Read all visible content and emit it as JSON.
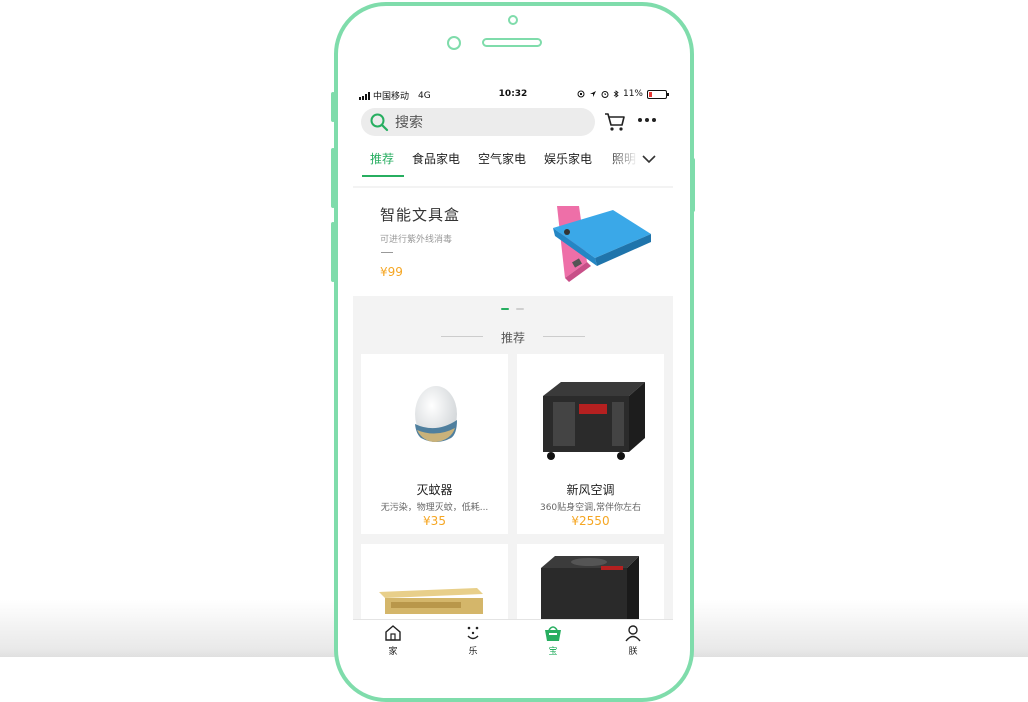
{
  "status_bar": {
    "carrier": "中国移动",
    "network": "4G",
    "time": "10:32",
    "battery": "11%"
  },
  "search": {
    "placeholder": "搜索"
  },
  "tabs": [
    {
      "label": "推荐",
      "active": true
    },
    {
      "label": "食品家电"
    },
    {
      "label": "空气家电"
    },
    {
      "label": "娱乐家电"
    },
    {
      "label": "照明"
    }
  ],
  "banner": {
    "title": "智能文具盒",
    "subtitle": "可进行紫外线消毒",
    "price": "¥99",
    "pages": 2,
    "current_page": 1
  },
  "section": {
    "title": "推荐"
  },
  "products": [
    {
      "name": "灭蚊器",
      "desc": "无污染，物理灭蚊，低耗...",
      "price": "¥35",
      "icon": "egg-mosquito-killer"
    },
    {
      "name": "新风空调",
      "desc": "360贴身空调,常伴你左右",
      "price": "¥2550",
      "icon": "air-conditioner-unit"
    },
    {
      "name": "",
      "desc": "",
      "price": "",
      "icon": "wood-heater"
    },
    {
      "name": "",
      "desc": "",
      "price": "",
      "icon": "dark-appliance"
    }
  ],
  "bottom_nav": [
    {
      "label": "家",
      "icon": "home-icon"
    },
    {
      "label": "乐",
      "icon": "face-icon"
    },
    {
      "label": "宝",
      "icon": "basket-icon",
      "active": true
    },
    {
      "label": "朕",
      "icon": "user-icon"
    }
  ],
  "colors": {
    "accent": "#27ae60",
    "price": "#f5a623",
    "frame": "#7fdcab"
  }
}
